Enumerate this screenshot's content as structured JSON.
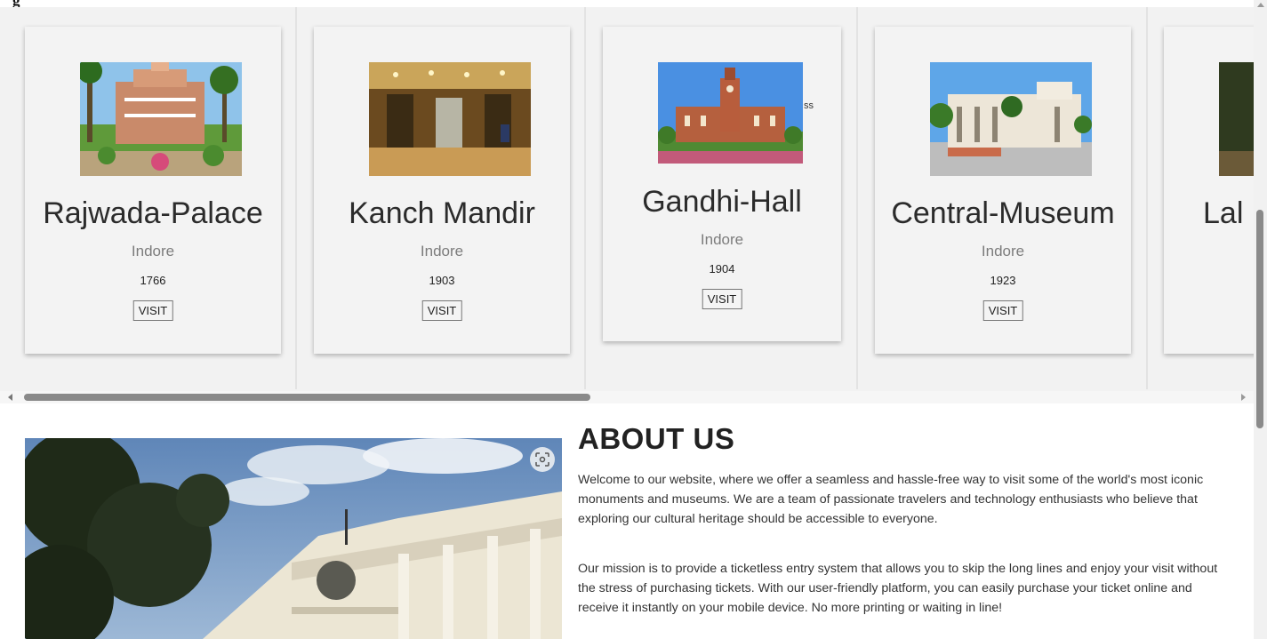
{
  "page": {
    "top_glyph": "g"
  },
  "gallery": {
    "cards": [
      {
        "title": "Rajwada-Palace",
        "city": "Indore",
        "year": "1766",
        "button": "VISIT"
      },
      {
        "title": "Kanch Mandir",
        "city": "Indore",
        "year": "1903",
        "button": "VISIT"
      },
      {
        "title": "Gandhi-Hall",
        "city": "Indore",
        "year": "1904",
        "button": "VISIT",
        "image_alt_fragment": "ss"
      },
      {
        "title": "Central-Museum",
        "city": "Indore",
        "year": "1923",
        "button": "VISIT"
      },
      {
        "title": "Lal"
      }
    ],
    "scroll_position_fraction": 0.0
  },
  "about": {
    "heading": "ABOUT US",
    "paragraph_1": "Welcome to our website, where we offer a seamless and hassle-free way to visit some of the world's most iconic monuments and museums. We are a team of passionate travelers and technology enthusiasts who believe that exploring our cultural heritage should be accessible to everyone.",
    "paragraph_2": "Our mission is to provide a ticketless entry system that allows you to skip the long lines and enjoy your visit without the stress of purchasing tickets. With our user-friendly platform, you can easily purchase your ticket online and receive it instantly on your mobile device. No more printing or waiting in line!",
    "photo_icon": "visual-search-icon"
  },
  "colors": {
    "card_background": "#f3f3f3",
    "gallery_background": "#f2f2f2",
    "scrollbar_thumb": "#8a8a8a"
  }
}
